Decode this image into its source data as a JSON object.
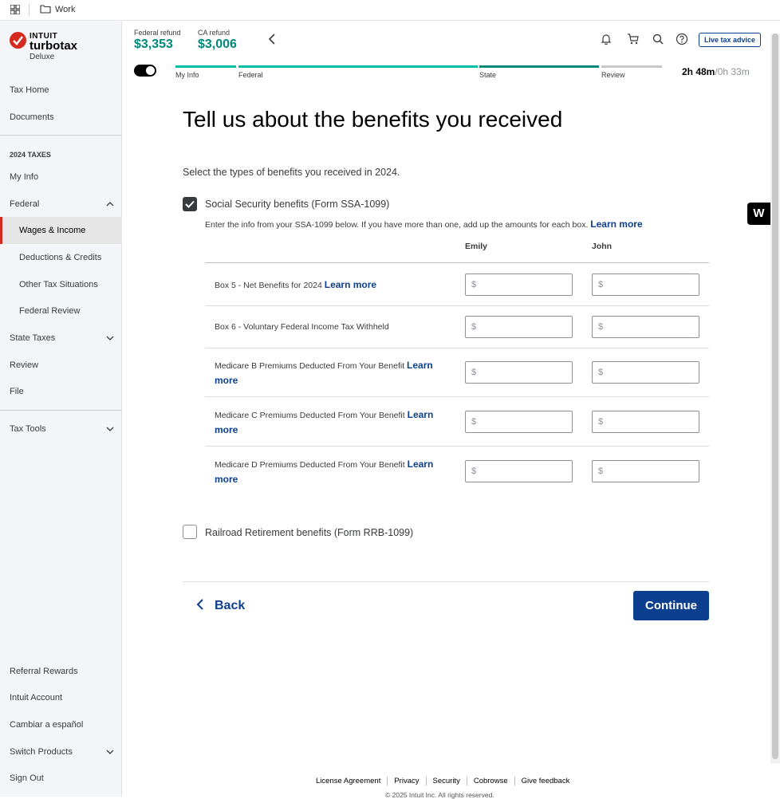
{
  "browser": {
    "tab_label": "Work"
  },
  "brand": {
    "intuit": "INTUIT",
    "product": "turbotax",
    "edition": "Deluxe"
  },
  "sidebar": {
    "top_items": [
      {
        "label": "Tax Home"
      },
      {
        "label": "Documents"
      }
    ],
    "section_heading": "2024 TAXES",
    "items": [
      {
        "label": "My Info"
      },
      {
        "label": "Federal"
      },
      {
        "label": "Wages & Income"
      },
      {
        "label": "Deductions & Credits"
      },
      {
        "label": "Other Tax Situations"
      },
      {
        "label": "Federal Review"
      },
      {
        "label": "State Taxes"
      },
      {
        "label": "Review"
      },
      {
        "label": "File"
      }
    ],
    "tools": {
      "label": "Tax Tools"
    },
    "bottom_items": [
      {
        "label": "Referral Rewards"
      },
      {
        "label": "Intuit Account"
      },
      {
        "label": "Cambiar a español"
      },
      {
        "label": "Switch Products"
      },
      {
        "label": "Sign Out"
      }
    ]
  },
  "header": {
    "federal_label": "Federal refund",
    "federal_amount": "$3,353",
    "state_label": "CA refund",
    "state_amount": "$3,006",
    "live_advice": "Live tax advice",
    "accent": "#00897b"
  },
  "progress": {
    "steps": [
      {
        "label": "My Info"
      },
      {
        "label": "Federal"
      },
      {
        "label": "State"
      },
      {
        "label": "Review"
      }
    ],
    "time_spent": "2h 48m",
    "time_sep": "/",
    "time_estimate": "0h 33m"
  },
  "main": {
    "title": "Tell us about the benefits you received",
    "intro": "Select the types of benefits you received in 2024.",
    "ssa": {
      "label": "Social Security benefits (Form SSA-1099)",
      "checked": true,
      "helper": "Enter the info from your SSA-1099 below. If you have more than one, add up the amounts for each box.",
      "helper_link": "Learn more",
      "columns": [
        "Emily",
        "John"
      ],
      "rows": [
        {
          "label": "Box 5 - Net Benefits for 2024",
          "link": "Learn more"
        },
        {
          "label": "Box 6 - Voluntary Federal Income Tax Withheld",
          "link": ""
        },
        {
          "label": "Medicare B Premiums Deducted From Your Benefit",
          "link": "Learn more"
        },
        {
          "label": "Medicare C Premiums Deducted From Your Benefit",
          "link": "Learn more"
        },
        {
          "label": "Medicare D Premiums Deducted From Your Benefit",
          "link": "Learn more"
        }
      ],
      "currency_prefix": "$"
    },
    "rrb": {
      "label": "Railroad Retirement benefits (Form RRB-1099)",
      "checked": false
    },
    "back_label": "Back",
    "continue_label": "Continue"
  },
  "footer": {
    "links": [
      "License Agreement",
      "Privacy",
      "Security",
      "Cobrowse",
      "Give feedback"
    ],
    "copyright": "© 2025 Intuit Inc. All rights reserved."
  },
  "badge": {
    "letter": "W"
  }
}
